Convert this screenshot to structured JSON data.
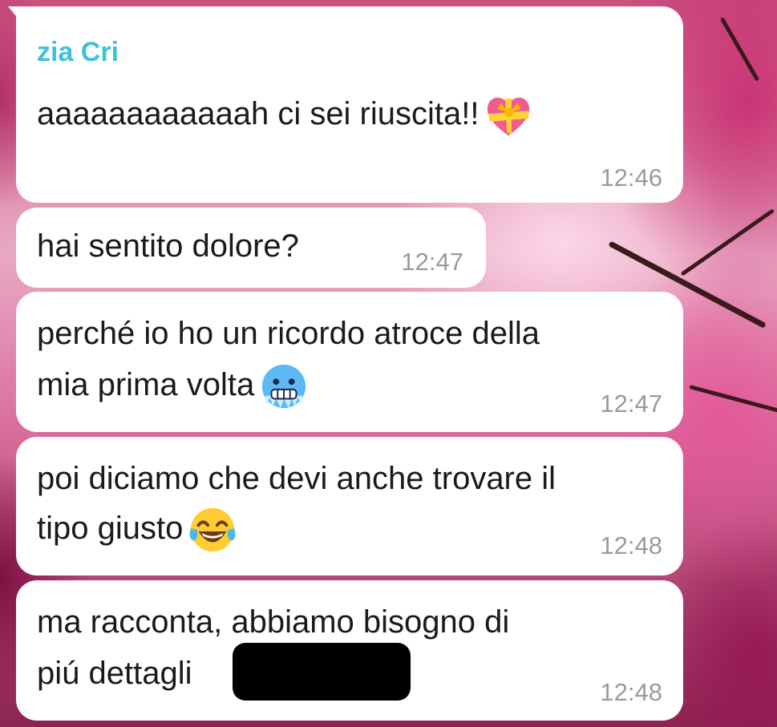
{
  "chat": {
    "sender_name": "zia Cri",
    "messages": [
      {
        "lines": [
          "aaaaaaaaaaaah ci sei riuscita!!"
        ],
        "emoji": "heart-with-ribbon-icon",
        "time": "12:46"
      },
      {
        "lines": [
          "hai sentito dolore?"
        ],
        "time": "12:47"
      },
      {
        "lines": [
          "perché io ho un ricordo atroce della",
          "mia prima volta"
        ],
        "emoji": "cold-face-icon",
        "time": "12:47"
      },
      {
        "lines": [
          "poi diciamo che devi anche trovare il",
          "tipo giusto"
        ],
        "emoji": "tears-of-joy-icon",
        "time": "12:48"
      },
      {
        "lines": [
          "ma racconta, abbiamo bisogno di",
          "piú dettagli"
        ],
        "redacted": true,
        "time": "12:48"
      }
    ]
  },
  "colors": {
    "sender": "#3ec1d9",
    "bubble": "#ffffff",
    "timestamp": "#9a9a9a",
    "text": "#1a1a1a"
  }
}
